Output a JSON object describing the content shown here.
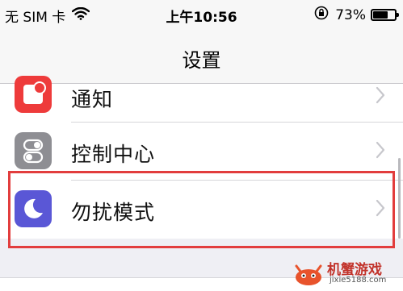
{
  "status_bar": {
    "carrier": "无 SIM 卡",
    "time": "上午10:56",
    "battery_percent": "73%",
    "battery_level": 0.73,
    "icons": [
      "wifi-icon",
      "orientation-lock-icon",
      "battery-icon"
    ]
  },
  "nav": {
    "title": "设置"
  },
  "settings": {
    "items": [
      {
        "label": "通知",
        "icon": "notification-icon",
        "icon_color": "#ee3b3b"
      },
      {
        "label": "控制中心",
        "icon": "control-center-icon",
        "icon_color": "#8e8e93"
      },
      {
        "label": "勿扰模式",
        "icon": "moon-icon",
        "icon_color": "#5a57d6"
      }
    ]
  },
  "highlight_color": "#e23d3d",
  "watermark": {
    "name": "机蟹游戏",
    "url": "jixie5188.com"
  }
}
